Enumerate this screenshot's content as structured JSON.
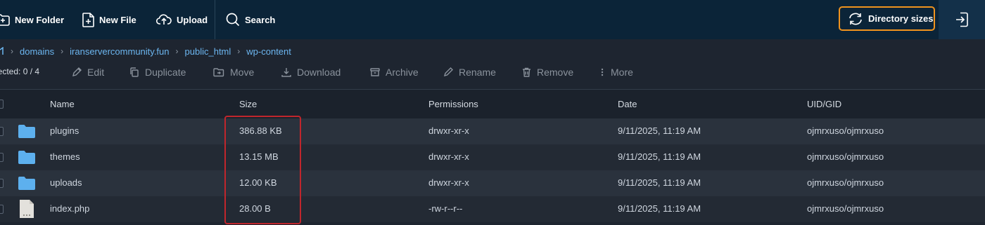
{
  "toolbar": {
    "new_folder": "New Folder",
    "new_file": "New File",
    "upload": "Upload",
    "search": "Search",
    "directory_sizes": "Directory sizes"
  },
  "breadcrumb": {
    "items": [
      "domains",
      "iranservercommunity.fun",
      "public_html",
      "wp-content"
    ]
  },
  "actions": {
    "selected": "lected: 0 / 4",
    "edit": "Edit",
    "duplicate": "Duplicate",
    "move": "Move",
    "download": "Download",
    "archive": "Archive",
    "rename": "Rename",
    "remove": "Remove",
    "more": "More"
  },
  "table": {
    "headers": {
      "name": "Name",
      "size": "Size",
      "permissions": "Permissions",
      "date": "Date",
      "uid": "UID/GID"
    },
    "rows": [
      {
        "name": "plugins",
        "size": "386.88 KB",
        "permissions": "drwxr-xr-x",
        "date": "9/11/2025, 11:19 AM",
        "uid": "ojmrxuso/ojmrxuso",
        "type": "folder-icon"
      },
      {
        "name": "themes",
        "size": "13.15 MB",
        "permissions": "drwxr-xr-x",
        "date": "9/11/2025, 11:19 AM",
        "uid": "ojmrxuso/ojmrxuso",
        "type": "folder-icon"
      },
      {
        "name": "uploads",
        "size": "12.00 KB",
        "permissions": "drwxr-xr-x",
        "date": "9/11/2025, 11:19 AM",
        "uid": "ojmrxuso/ojmrxuso",
        "type": "folder-icon"
      },
      {
        "name": "index.php",
        "size": "28.00 B",
        "permissions": "-rw-r--r--",
        "date": "9/11/2025, 11:19 AM",
        "uid": "ojmrxuso/ojmrxuso",
        "type": "file-icon"
      }
    ]
  },
  "colors": {
    "topbar": "#0b2438",
    "accent_link": "#6cb6f0",
    "folder": "#5db0ee",
    "highlight_orange": "#f0931e",
    "highlight_red": "#c0262c"
  }
}
